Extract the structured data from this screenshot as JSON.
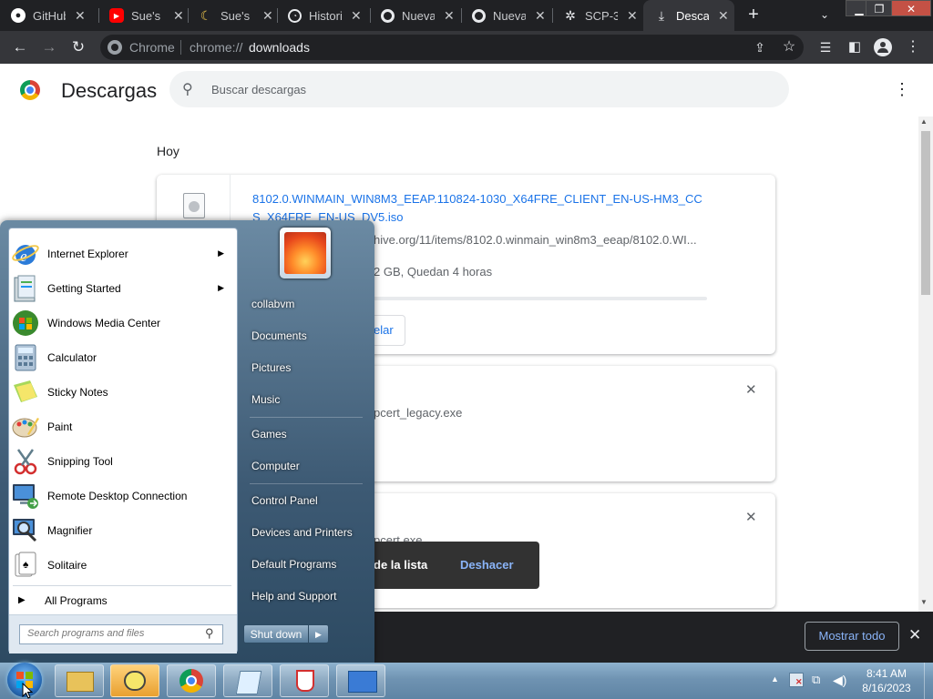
{
  "tabs": [
    {
      "title": "GitHub",
      "icon": "github-icon",
      "icon_color": "#ffffff"
    },
    {
      "title": "Sue's Ex",
      "icon": "youtube-icon",
      "icon_color": "#ff0000"
    },
    {
      "title": "Sue's Fr",
      "icon": "banana-icon",
      "icon_color": "#f2c94c"
    },
    {
      "title": "Historial",
      "icon": "history-icon",
      "icon_color": "#e8eaed"
    },
    {
      "title": "Nueva",
      "icon": "chrome-icon",
      "icon_color": "#e8eaed"
    },
    {
      "title": "Nueva",
      "icon": "chrome-icon",
      "icon_color": "#e8eaed"
    },
    {
      "title": "SCP-3",
      "icon": "scp-icon",
      "icon_color": "#e8eaed"
    },
    {
      "title": "Descargas",
      "icon": "download-icon",
      "icon_color": "#e8eaed",
      "active": true
    }
  ],
  "omnibox": {
    "site_label": "Chrome",
    "url_prefix": "chrome://",
    "url_path": "downloads"
  },
  "downloads_page": {
    "title": "Descargas",
    "search_placeholder": "Buscar descargas",
    "date_header": "Hoy",
    "item1": {
      "filename": "8102.0.WINMAIN_WIN8M3_EEAP.110824-1030_X64FRE_CLIENT_EN-US-HM3_CCS_X64FRE_EN-US_DV5.iso",
      "url": "hive.org/11/items/8102.0.winmain_win8m3_eeap/8102.0.WI...",
      "status": "2 GB, Quedan 4 horas",
      "cancel_label": "elar",
      "progress": 0.0
    },
    "item2": {
      "filename": "pcert_legacy.exe"
    },
    "item3": {
      "filename": "pcert.exe"
    },
    "toast": {
      "message": "de la lista",
      "undo_label": "Deshacer"
    }
  },
  "shelf": {
    "show_all_label": "Mostrar todo"
  },
  "start_menu": {
    "programs": [
      {
        "label": "Internet Explorer",
        "icon": "internet-explorer-icon",
        "has_submenu": true
      },
      {
        "label": "Getting Started",
        "icon": "getting-started-icon",
        "has_submenu": true
      },
      {
        "label": "Windows Media Center",
        "icon": "media-center-icon",
        "has_submenu": false
      },
      {
        "label": "Calculator",
        "icon": "calculator-icon",
        "has_submenu": false
      },
      {
        "label": "Sticky Notes",
        "icon": "sticky-notes-icon",
        "has_submenu": false
      },
      {
        "label": "Paint",
        "icon": "paint-icon",
        "has_submenu": false
      },
      {
        "label": "Snipping Tool",
        "icon": "snipping-tool-icon",
        "has_submenu": false
      },
      {
        "label": "Remote Desktop Connection",
        "icon": "remote-desktop-icon",
        "has_submenu": false
      },
      {
        "label": "Magnifier",
        "icon": "magnifier-icon",
        "has_submenu": false
      },
      {
        "label": "Solitaire",
        "icon": "solitaire-icon",
        "has_submenu": false
      }
    ],
    "all_programs_label": "All Programs",
    "search_placeholder": "Search programs and files",
    "right_links": [
      "collabvm",
      "Documents",
      "Pictures",
      "Music",
      "Games",
      "Computer",
      "Control Panel",
      "Devices and Printers",
      "Default Programs",
      "Help and Support"
    ],
    "shutdown_label": "Shut down"
  },
  "taskbar": {
    "apps": [
      "explorer-icon",
      "sticky-notes-icon",
      "chrome-icon",
      "notepad-icon",
      "java-icon",
      "control-panel-icon"
    ],
    "clock_time": "8:41 AM",
    "clock_date": "8/16/2023"
  }
}
